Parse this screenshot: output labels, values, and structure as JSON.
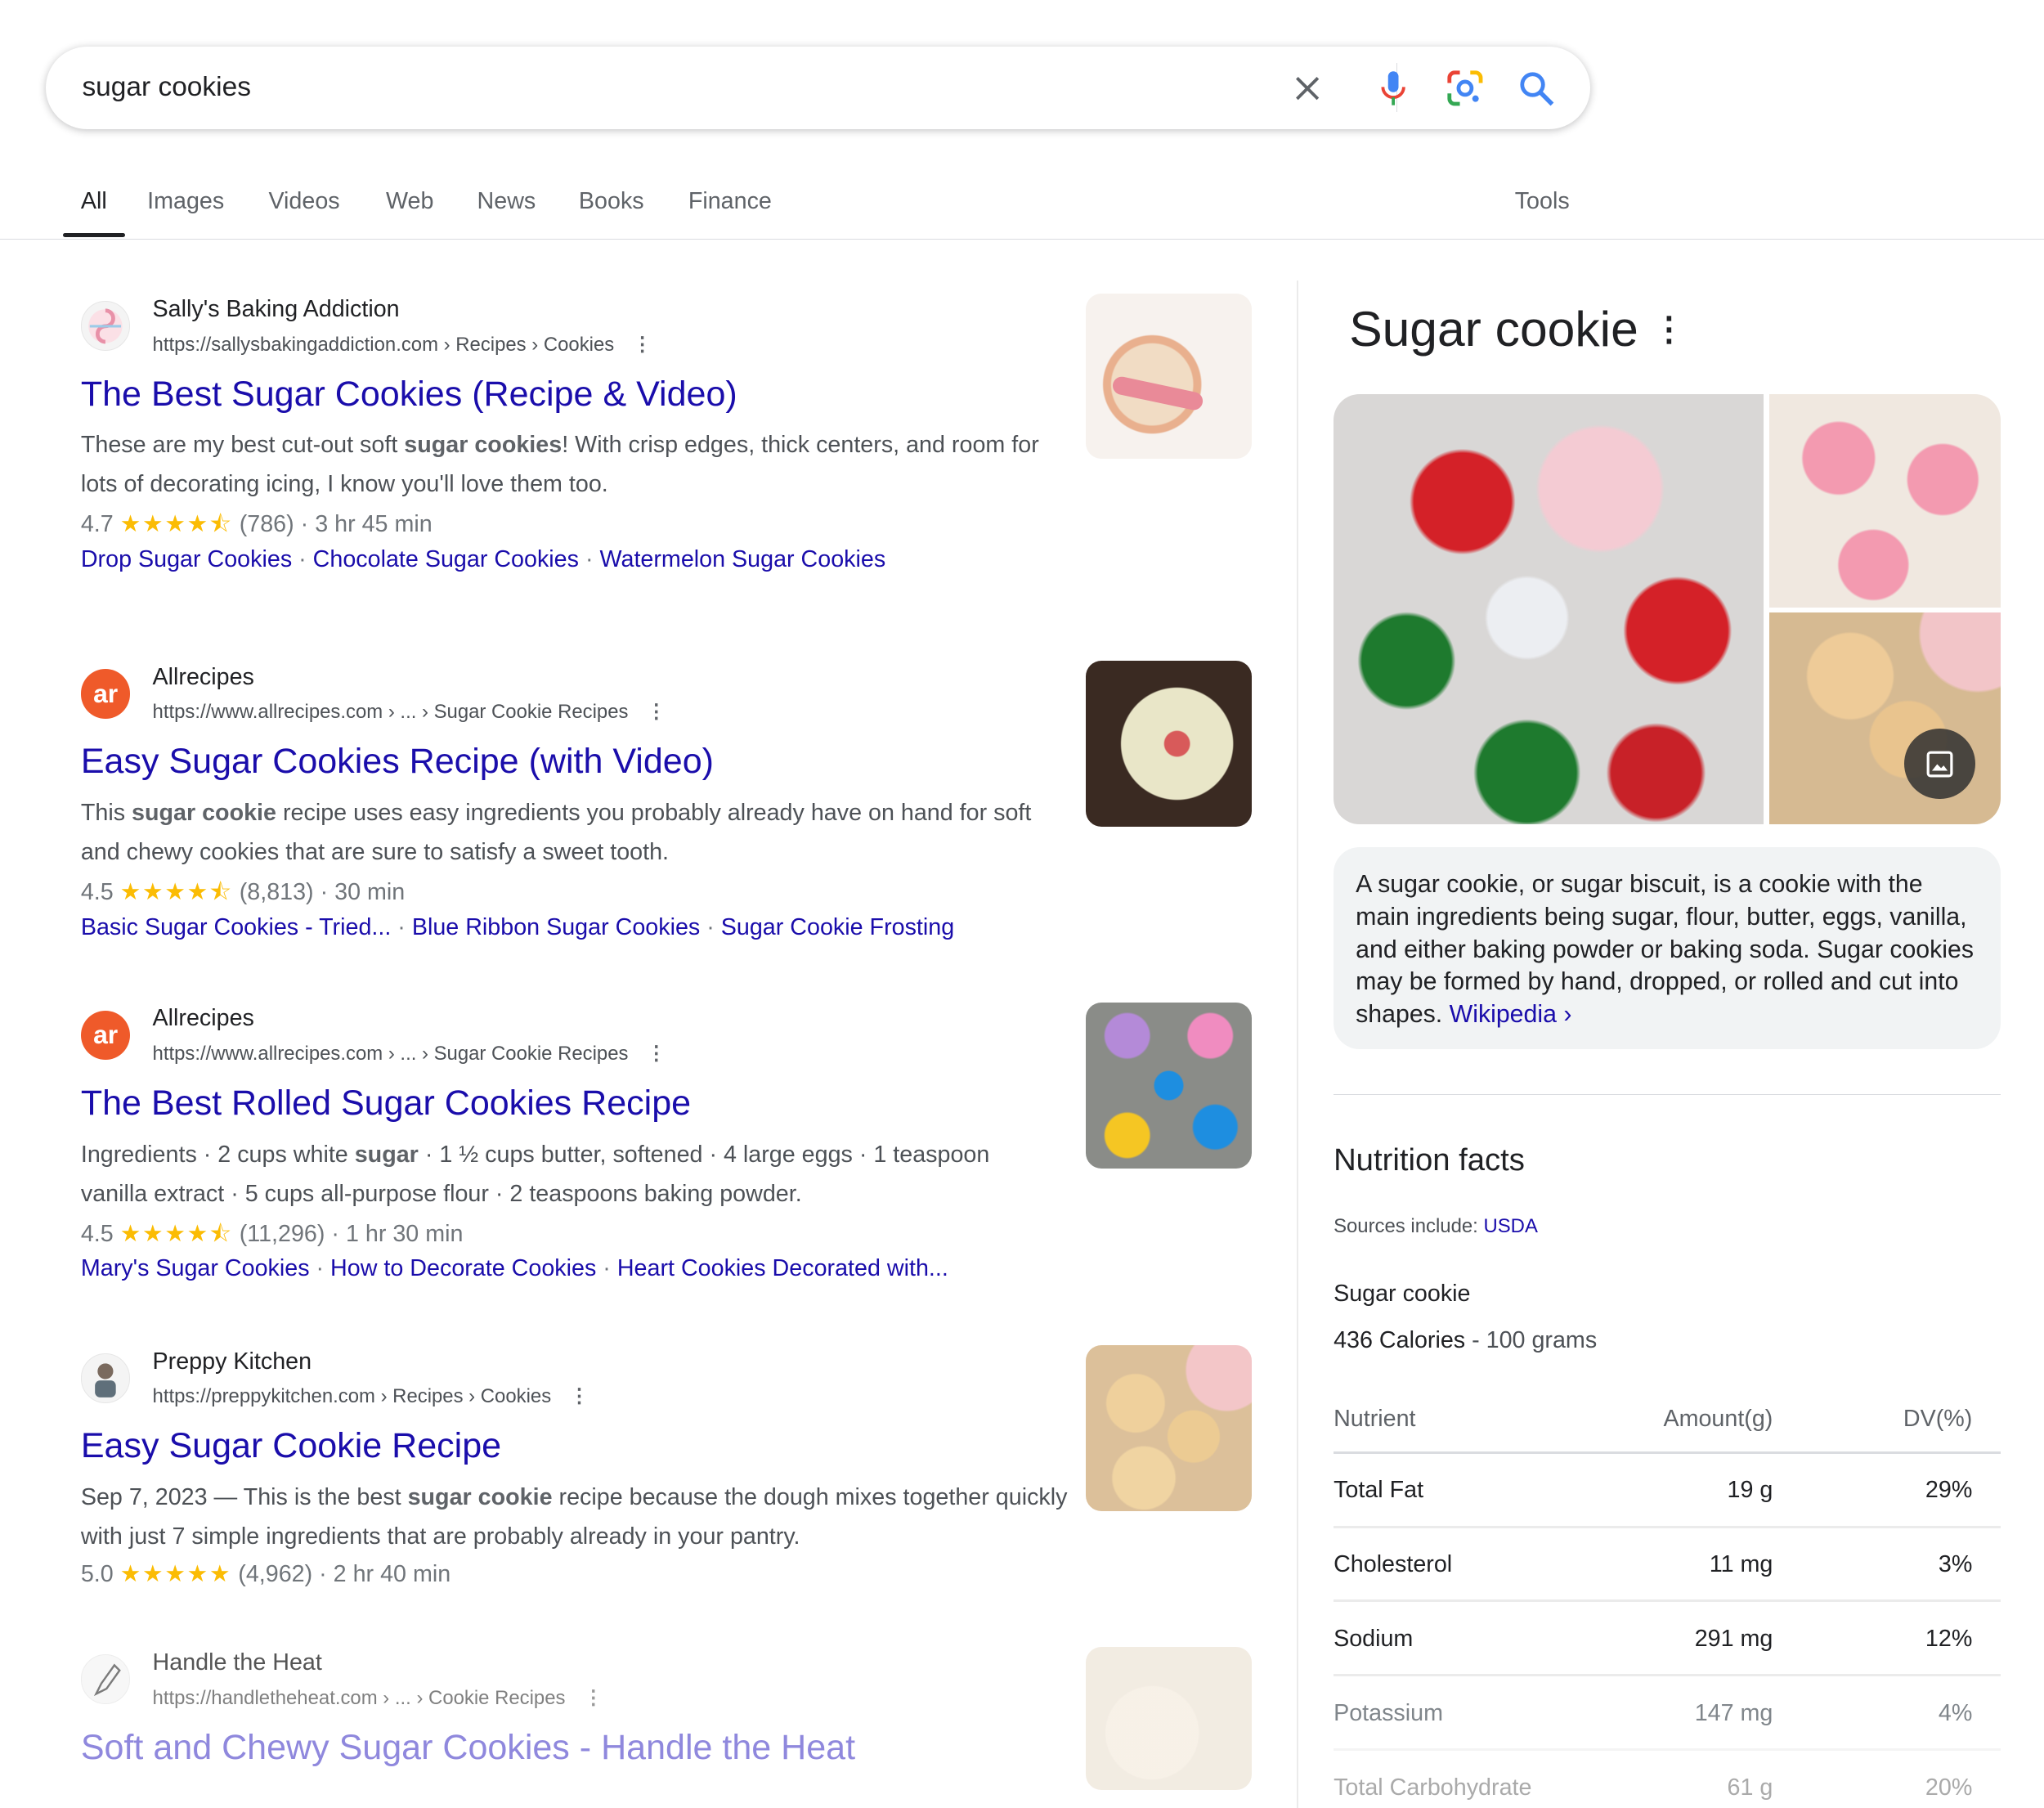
{
  "search": {
    "query": "sugar cookies"
  },
  "tabs": [
    {
      "label": "All"
    },
    {
      "label": "Images"
    },
    {
      "label": "Videos"
    },
    {
      "label": "Web"
    },
    {
      "label": "News"
    },
    {
      "label": "Books"
    },
    {
      "label": "Finance"
    }
  ],
  "tools_label": "Tools",
  "results": [
    {
      "site": "Sally's Baking Addiction",
      "url": "https://sallysbakingaddiction.com › Recipes › Cookies",
      "title": "The Best Sugar Cookies (Recipe & Video)",
      "snippet_html": "These are my best cut-out soft <b>sugar cookies</b>! With crisp edges, thick centers, and room for lots of decorating icing, I know you'll love them too.",
      "rating": "4.7",
      "stars": "★★★★⯪",
      "reviews": "(786)",
      "time": "3 hr 45 min",
      "links": [
        "Drop Sugar Cookies",
        "Chocolate Sugar Cookies",
        "Watermelon Sugar Cookies"
      ]
    },
    {
      "site": "Allrecipes",
      "url": "https://www.allrecipes.com › ... › Sugar Cookie Recipes",
      "title": "Easy Sugar Cookies Recipe (with Video)",
      "snippet_html": "This <b>sugar cookie</b> recipe uses easy ingredients you probably already have on hand for soft and chewy cookies that are sure to satisfy a sweet tooth.",
      "rating": "4.5",
      "stars": "★★★★⯪",
      "reviews": "(8,813)",
      "time": "30 min",
      "links": [
        "Basic Sugar Cookies - Tried...",
        "Blue Ribbon Sugar Cookies",
        "Sugar Cookie Frosting"
      ]
    },
    {
      "site": "Allrecipes",
      "url": "https://www.allrecipes.com › ... › Sugar Cookie Recipes",
      "title": "The Best Rolled Sugar Cookies Recipe",
      "snippet_html": "Ingredients · 2 cups white <b>sugar</b> · 1 ½ cups butter, softened · 4 large eggs · 1 teaspoon vanilla extract · 5 cups all-purpose flour · 2 teaspoons baking powder.",
      "rating": "4.5",
      "stars": "★★★★⯪",
      "reviews": "(11,296)",
      "time": "1 hr 30 min",
      "links": [
        "Mary's Sugar Cookies",
        "How to Decorate Cookies",
        "Heart Cookies Decorated with..."
      ]
    },
    {
      "site": "Preppy Kitchen",
      "url": "https://preppykitchen.com › Recipes › Cookies",
      "title": "Easy Sugar Cookie Recipe",
      "snippet_html": "Sep 7, 2023 — This is the best <b>sugar cookie</b> recipe because the dough mixes together quickly with just 7 simple ingredients that are probably already in your pantry.",
      "rating": "5.0",
      "stars": "★★★★★",
      "reviews": "(4,962)",
      "time": "2 hr 40 min",
      "links": []
    },
    {
      "site": "Handle the Heat",
      "url": "https://handletheheat.com › ... › Cookie Recipes",
      "title": "Soft and Chewy Sugar Cookies - Handle the Heat",
      "snippet_html": "",
      "links": []
    }
  ],
  "knowledge_panel": {
    "title": "Sugar cookie",
    "description": "A sugar cookie, or sugar biscuit, is a cookie with the main ingredients being sugar, flour, butter, eggs, vanilla, and either baking powder or baking soda. Sugar cookies may be formed by hand, dropped, or rolled and cut into shapes.",
    "source_link": "Wikipedia ›",
    "nutrition": {
      "heading": "Nutrition facts",
      "sources_label": "Sources include:",
      "sources_link": "USDA",
      "food": "Sugar cookie",
      "calories": "436 Calories",
      "serving": "- 100 grams",
      "headers": [
        "Nutrient",
        "Amount(g)",
        "DV(%)"
      ],
      "rows": [
        [
          "Total Fat",
          "19 g",
          "29%"
        ],
        [
          "Cholesterol",
          "11 mg",
          "3%"
        ],
        [
          "Sodium",
          "291 mg",
          "12%"
        ],
        [
          "Potassium",
          "147 mg",
          "4%"
        ],
        [
          "Total Carbohydrate",
          "61 g",
          "20%"
        ]
      ]
    }
  },
  "colors": {
    "link": "#1a0dab",
    "star": "#fbbc04",
    "text": "#202124",
    "secondary": "#4d5156"
  }
}
